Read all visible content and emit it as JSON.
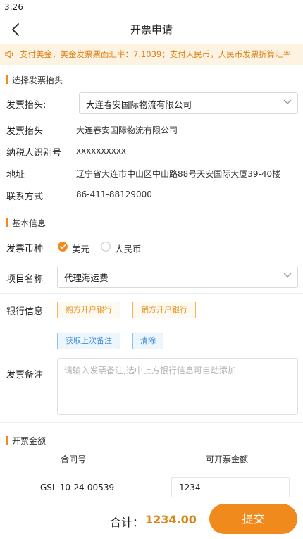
{
  "status_bar": {
    "time": "3:26"
  },
  "nav": {
    "title": "开票申请"
  },
  "notice": {
    "text": "支付美金，美金发票票面汇率：7.1039；支付人民币，人民币发票折算汇率"
  },
  "header_section": {
    "title": "选择发票抬头",
    "select_label": "发票抬头:",
    "selected": "大连春安国际物流有限公司",
    "rows": [
      {
        "label": "发票抬头",
        "value": "大连春安国际物流有限公司"
      },
      {
        "label": "纳税人识别号",
        "value": "xxxxxxxxxx"
      },
      {
        "label": "地址",
        "value": "辽宁省大连市中山区中山路88号天安国际大厦39-40楼"
      },
      {
        "label": "联系方式",
        "value": "86-411-88129000"
      }
    ]
  },
  "basic_section": {
    "title": "基本信息",
    "currency": {
      "label": "发票币种",
      "options": [
        "美元",
        "人民币"
      ],
      "selected": "美元"
    },
    "project": {
      "label": "项目名称",
      "value": "代理海运费"
    },
    "bank": {
      "label": "银行信息",
      "buyer_button": "购方开户银行",
      "seller_button": "销方开户银行"
    },
    "remark": {
      "label": "发票备注",
      "fetch_button": "获取上次备注",
      "clear_button": "清除",
      "placeholder": "请输入发票备注,选中上方银行信息可自动添加"
    }
  },
  "amount_section": {
    "title": "开票金额",
    "columns": [
      "合同号",
      "可开票金额"
    ],
    "rows": [
      {
        "contract": "GSL-10-24-00539",
        "amount": "1234"
      }
    ]
  },
  "footer": {
    "total_label": "合计：",
    "total_value": "1234.00",
    "submit_label": "提交"
  },
  "colors": {
    "accent": "#f08a1c",
    "notice_bg": "#fdf3e3",
    "link_blue": "#3d8fd8"
  }
}
